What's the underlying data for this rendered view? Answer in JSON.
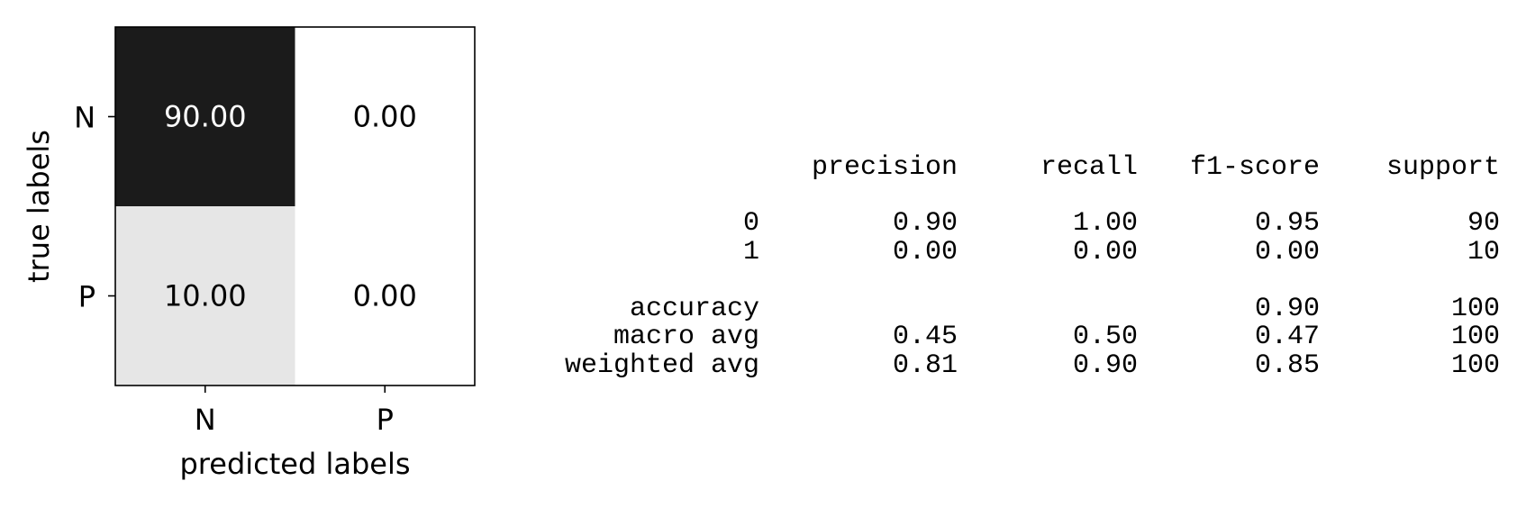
{
  "chart_data": [
    {
      "type": "heatmap",
      "xlabel": "predicted labels",
      "ylabel": "true labels",
      "x_categories": [
        "N",
        "P"
      ],
      "y_categories": [
        "N",
        "P"
      ],
      "values": [
        [
          90.0,
          0.0
        ],
        [
          10.0,
          0.0
        ]
      ],
      "value_labels": [
        [
          "90.00",
          "0.00"
        ],
        [
          "10.00",
          "0.00"
        ]
      ],
      "colormap": "greys",
      "vmin": 0,
      "vmax": 90
    },
    {
      "type": "table",
      "columns": [
        "precision",
        "recall",
        "f1-score",
        "support"
      ],
      "rows": [
        {
          "label": "0",
          "values": [
            "0.90",
            "1.00",
            "0.95",
            "90"
          ]
        },
        {
          "label": "1",
          "values": [
            "0.00",
            "0.00",
            "0.00",
            "10"
          ]
        },
        {
          "label": "accuracy",
          "values": [
            "",
            "",
            "0.90",
            "100"
          ]
        },
        {
          "label": "macro avg",
          "values": [
            "0.45",
            "0.50",
            "0.47",
            "100"
          ]
        },
        {
          "label": "weighted avg",
          "values": [
            "0.81",
            "0.90",
            "0.85",
            "100"
          ]
        }
      ]
    }
  ]
}
